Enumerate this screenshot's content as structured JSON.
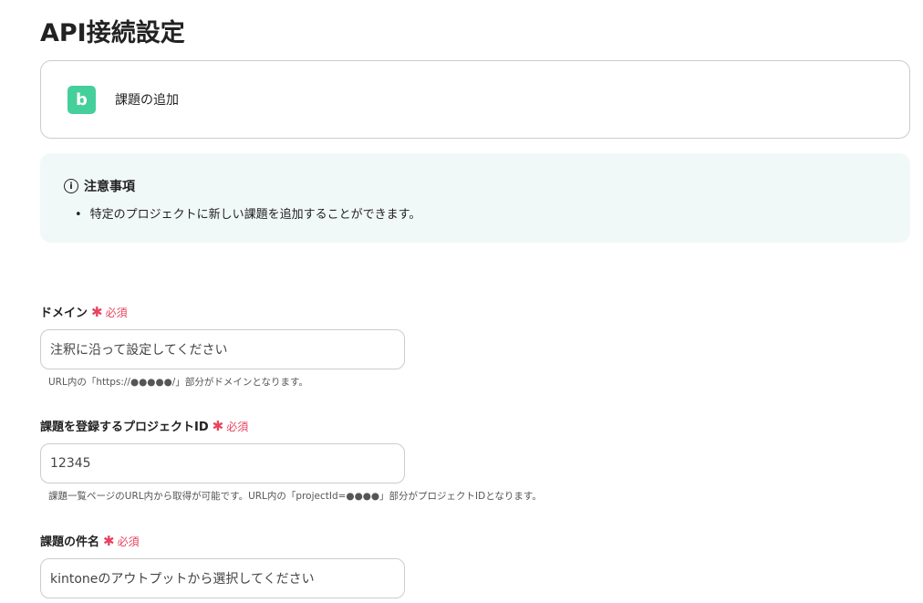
{
  "page_title": "API接続設定",
  "app": {
    "icon_letter": "b",
    "action": "課題の追加",
    "brand_color": "#45cf9b"
  },
  "notice": {
    "icon": "i",
    "heading": "注意事項",
    "items": [
      "特定のプロジェクトに新しい課題を追加することができます。"
    ]
  },
  "fields": [
    {
      "label": "ドメイン",
      "required": "必須",
      "star": "✱",
      "value": "注釈に沿って設定してください",
      "hint": "URL内の「https://●●●●●/」部分がドメインとなります。"
    },
    {
      "label": "課題を登録するプロジェクトID",
      "required": "必須",
      "star": "✱",
      "value": "12345",
      "hint": "課題一覧ページのURL内から取得が可能です。URL内の「projectId=●●●●」部分がプロジェクトIDとなります。"
    },
    {
      "label": "課題の件名",
      "required": "必須",
      "star": "✱",
      "value": "kintoneのアウトプットから選択してください"
    }
  ]
}
